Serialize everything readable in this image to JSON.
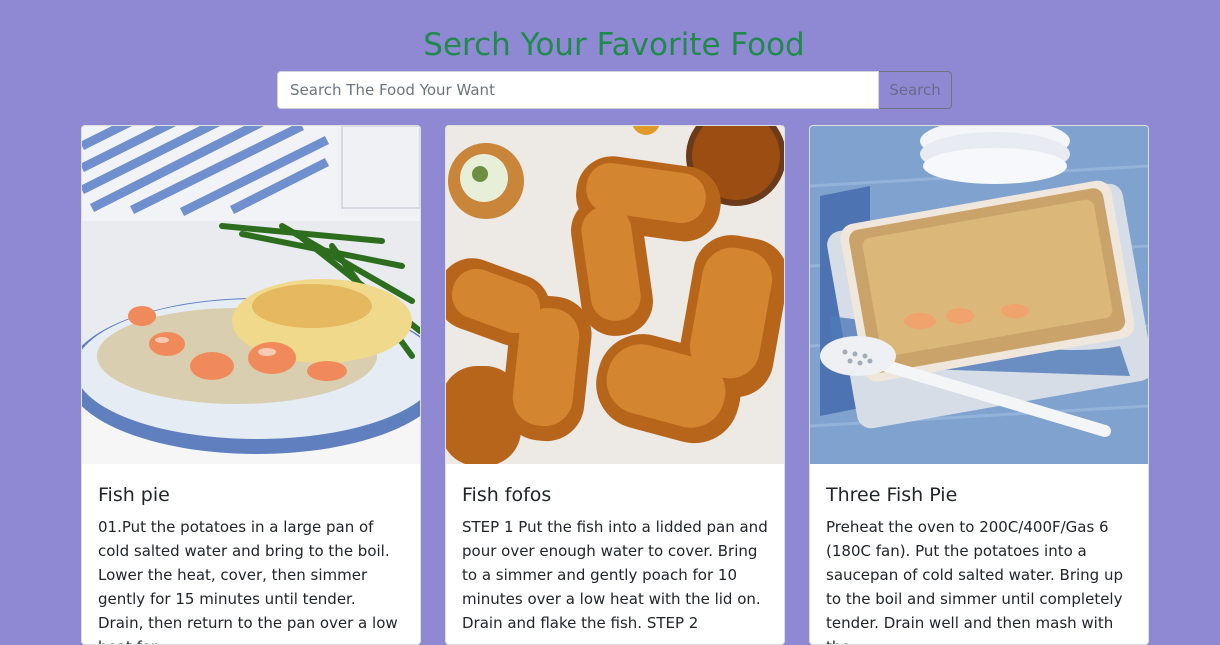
{
  "header": {
    "title": "Serch Your Favorite Food"
  },
  "search": {
    "placeholder": "Search The Food Your Want",
    "value": "",
    "button_label": "Search"
  },
  "meals": [
    {
      "name": "Fish pie",
      "image_alt": "Fish pie",
      "description": "01.Put the potatoes in a large pan of cold salted water and bring to the boil. Lower the heat, cover, then simmer gently for 15 minutes until tender. Drain, then return to the pan over a low heat for"
    },
    {
      "name": "Fish fofos",
      "image_alt": "Fish fofos",
      "description": "STEP 1 Put the fish into a lidded pan and pour over enough water to cover. Bring to a simmer and gently poach for 10 minutes over a low heat with the lid on. Drain and flake the fish. STEP 2"
    },
    {
      "name": "Three Fish Pie",
      "image_alt": "Three Fish Pie",
      "description": "Preheat the oven to 200C/400F/Gas 6 (180C fan). Put the potatoes into a saucepan of cold salted water. Bring up to the boil and simmer until completely tender. Drain well and then mash with the"
    }
  ],
  "colors": {
    "page_background": "#8f89d4",
    "title": "#1f8a4c",
    "card_background": "#ffffff",
    "text": "#212529"
  }
}
